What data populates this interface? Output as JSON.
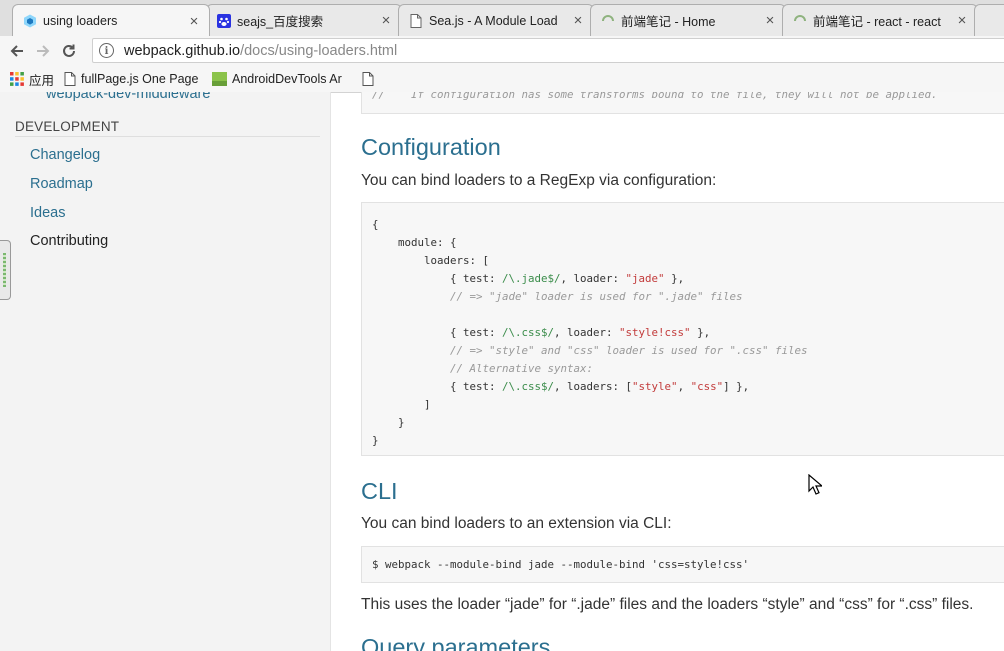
{
  "tabs": [
    {
      "title": "using loaders",
      "icon": "webpack-icon",
      "active": true
    },
    {
      "title": "seajs_百度搜索",
      "icon": "baidu-paw-icon",
      "active": false
    },
    {
      "title": "Sea.js - A Module Load",
      "icon": "document-icon",
      "active": false
    },
    {
      "title": "前端笔记 - Home",
      "icon": "loading-icon",
      "active": false
    },
    {
      "title": "前端笔记 - react - react",
      "icon": "loading-icon",
      "active": false
    }
  ],
  "toolbar": {
    "url_host": "webpack.github.io",
    "url_path": "/docs/using-loaders.html"
  },
  "bookmarks": [
    {
      "label": "应用",
      "icon": "apps-grid-icon"
    },
    {
      "label": "fullPage.js One Page",
      "icon": "document-icon"
    },
    {
      "label": "AndroidDevTools Ar",
      "icon": "android-devtools-icon"
    },
    {
      "label": "",
      "icon": "document-icon"
    }
  ],
  "sidebar": {
    "sublink": "webpack-dev-middleware",
    "section": "DEVELOPMENT",
    "items": [
      {
        "label": "Changelog",
        "current": false
      },
      {
        "label": "Roadmap",
        "current": false
      },
      {
        "label": "Ideas",
        "current": false
      },
      {
        "label": "Contributing",
        "current": true
      }
    ]
  },
  "content": {
    "top_code_comment": "//    If configuration has some transforms bound to the file, they will not be applied.",
    "config_heading": "Configuration",
    "config_text": "You can bind loaders to a RegExp via configuration:",
    "config_code": [
      [
        {
          "t": "{",
          "c": "plain"
        }
      ],
      [
        {
          "t": "    module: {",
          "c": "plain"
        }
      ],
      [
        {
          "t": "        loaders: [",
          "c": "plain"
        }
      ],
      [
        {
          "t": "            { test: ",
          "c": "plain"
        },
        {
          "t": "/\\.jade$/",
          "c": "re"
        },
        {
          "t": ", loader: ",
          "c": "plain"
        },
        {
          "t": "\"jade\"",
          "c": "str"
        },
        {
          "t": " },",
          "c": "plain"
        }
      ],
      [
        {
          "t": "            // => \"jade\" loader is used for \".jade\" files",
          "c": "comment"
        }
      ],
      [
        {
          "t": "",
          "c": "plain"
        }
      ],
      [
        {
          "t": "            { test: ",
          "c": "plain"
        },
        {
          "t": "/\\.css$/",
          "c": "re"
        },
        {
          "t": ", loader: ",
          "c": "plain"
        },
        {
          "t": "\"style!css\"",
          "c": "str"
        },
        {
          "t": " },",
          "c": "plain"
        }
      ],
      [
        {
          "t": "            // => \"style\" and \"css\" loader is used for \".css\" files",
          "c": "comment"
        }
      ],
      [
        {
          "t": "            // Alternative syntax:",
          "c": "comment"
        }
      ],
      [
        {
          "t": "            { test: ",
          "c": "plain"
        },
        {
          "t": "/\\.css$/",
          "c": "re"
        },
        {
          "t": ", loaders: [",
          "c": "plain"
        },
        {
          "t": "\"style\"",
          "c": "str"
        },
        {
          "t": ", ",
          "c": "plain"
        },
        {
          "t": "\"css\"",
          "c": "str"
        },
        {
          "t": "] },",
          "c": "plain"
        }
      ],
      [
        {
          "t": "        ]",
          "c": "plain"
        }
      ],
      [
        {
          "t": "    }",
          "c": "plain"
        }
      ],
      [
        {
          "t": "}",
          "c": "plain"
        }
      ]
    ],
    "cli_heading": "CLI",
    "cli_text": "You can bind loaders to an extension via CLI:",
    "cli_code": "$ webpack --module-bind jade --module-bind 'css=style!css'",
    "cli_after": "This uses the loader “jade” for “.jade” files and the loaders “style” and “css” for “.css” files.",
    "query_heading": "Query parameters"
  },
  "colors": {
    "link": "#2b6f8f",
    "code_string": "#c23a3a",
    "code_regexp": "#3a8c4a",
    "code_comment": "#999999"
  }
}
